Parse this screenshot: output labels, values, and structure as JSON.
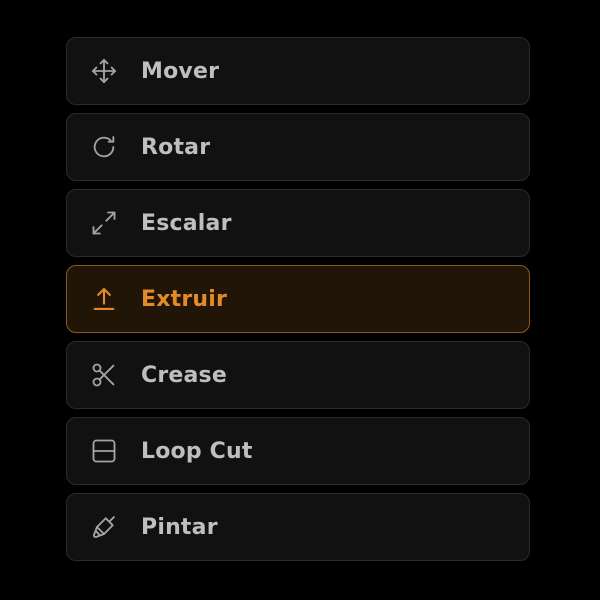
{
  "toolbar": {
    "items": [
      {
        "label": "Mover",
        "icon": "move-icon",
        "active": false
      },
      {
        "label": "Rotar",
        "icon": "rotate-icon",
        "active": false
      },
      {
        "label": "Escalar",
        "icon": "scale-icon",
        "active": false
      },
      {
        "label": "Extruir",
        "icon": "extrude-icon",
        "active": true
      },
      {
        "label": "Crease",
        "icon": "scissors-icon",
        "active": false
      },
      {
        "label": "Loop Cut",
        "icon": "loop-cut-icon",
        "active": false
      },
      {
        "label": "Pintar",
        "icon": "paint-brush-icon",
        "active": false
      }
    ]
  },
  "colors": {
    "background": "#000000",
    "item_background": "#111111",
    "item_border": "#2a2a2a",
    "text": "#bfbfbf",
    "icon": "#a3a3a3",
    "accent": "#e38b2a",
    "active_background": "#211507",
    "active_border": "#8a5a1c"
  }
}
